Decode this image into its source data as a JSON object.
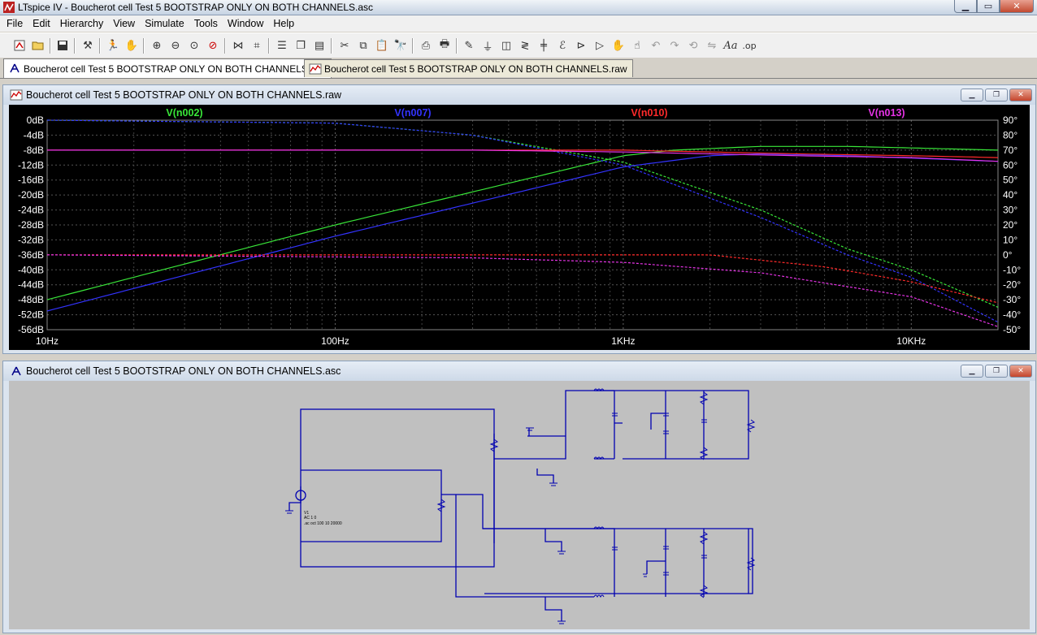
{
  "window": {
    "title": "LTspice IV - Boucherot cell Test 5 BOOTSTRAP ONLY ON BOTH CHANNELS.asc",
    "buttons": [
      "minimize-icon",
      "maximize-icon",
      "close-icon"
    ]
  },
  "menu": [
    "File",
    "Edit",
    "Hierarchy",
    "View",
    "Simulate",
    "Tools",
    "Window",
    "Help"
  ],
  "toolbar": {
    "icons": [
      "new-schematic-icon",
      "open-icon",
      "save-icon",
      "control-panel-icon",
      "run-icon",
      "halt-icon",
      "zoom-in-icon",
      "zoom-out-icon",
      "zoom-fit-icon",
      "cancel-zoom-icon",
      "autorange-icon",
      "cursor-icon",
      "tile-vertical-icon",
      "cascade-icon",
      "tile-horizontal-icon",
      "cut-icon",
      "copy-icon",
      "paste-icon",
      "find-icon",
      "print-setup-icon",
      "print-icon",
      "wire-icon",
      "ground-icon",
      "label-icon",
      "resistor-icon",
      "capacitor-icon",
      "inductor-icon",
      "diode-icon",
      "component-icon",
      "move-icon",
      "drag-icon",
      "undo-icon",
      "redo-icon",
      "rotate-icon",
      "mirror-icon",
      "text-icon",
      "spice-directive-icon"
    ],
    "text_label": "Aa",
    "op_label": ".op"
  },
  "tabs": [
    {
      "label": "Boucherot cell Test 5 BOOTSTRAP ONLY ON BOTH CHANNELS.asc",
      "icon": "schematic-icon",
      "active": true
    },
    {
      "label": "Boucherot cell Test 5 BOOTSTRAP ONLY ON BOTH CHANNELS.raw",
      "icon": "waveform-icon",
      "active": false
    }
  ],
  "plot_window": {
    "title": "Boucherot cell Test 5 BOOTSTRAP ONLY ON BOTH CHANNELS.raw"
  },
  "schematic_window": {
    "title": "Boucherot cell Test 5 BOOTSTRAP ONLY ON BOTH CHANNELS.asc",
    "source_labels": [
      "V1",
      "AC 1 0",
      ".ac oct 100 10 20000"
    ]
  },
  "chart_data": {
    "type": "line",
    "x_scale": "log",
    "xlim": [
      10,
      20000
    ],
    "x_ticks": [
      {
        "value": 10,
        "label": "10Hz"
      },
      {
        "value": 100,
        "label": "100Hz"
      },
      {
        "value": 1000,
        "label": "1KHz"
      },
      {
        "value": 10000,
        "label": "10KHz"
      }
    ],
    "ylim": [
      -56,
      0
    ],
    "y_ticks": [
      "0dB",
      "-4dB",
      "-8dB",
      "-12dB",
      "-16dB",
      "-20dB",
      "-24dB",
      "-28dB",
      "-32dB",
      "-36dB",
      "-40dB",
      "-44dB",
      "-48dB",
      "-52dB",
      "-56dB"
    ],
    "y_tick_values": [
      0,
      -4,
      -8,
      -12,
      -16,
      -20,
      -24,
      -28,
      -32,
      -36,
      -40,
      -44,
      -48,
      -52,
      -56
    ],
    "y2lim": [
      -50,
      90
    ],
    "y2_ticks": [
      "90°",
      "80°",
      "70°",
      "60°",
      "50°",
      "40°",
      "30°",
      "20°",
      "10°",
      "0°",
      "-10°",
      "-20°",
      "-30°",
      "-40°",
      "-50°"
    ],
    "y2_tick_values": [
      90,
      80,
      70,
      60,
      50,
      40,
      30,
      20,
      10,
      0,
      -10,
      -20,
      -30,
      -40,
      -50
    ],
    "grid": true,
    "background": "#000000",
    "series": [
      {
        "name": "V(n002)",
        "color": "#39e639",
        "magnitude_db": {
          "x": [
            10,
            100,
            1000,
            1500,
            3000,
            6000,
            20000
          ],
          "y": [
            -48,
            -28,
            -9.5,
            -8,
            -7,
            -7,
            -8
          ]
        },
        "phase_deg": {
          "x": [
            10,
            100,
            300,
            1000,
            3000,
            6000,
            10000,
            20000
          ],
          "y": [
            90,
            88,
            80,
            62,
            30,
            4,
            -10,
            -35
          ]
        }
      },
      {
        "name": "V(n007)",
        "color": "#3333ff",
        "magnitude_db": {
          "x": [
            10,
            100,
            1000,
            2000,
            3000,
            6000,
            20000
          ],
          "y": [
            -51,
            -31,
            -12.5,
            -9.5,
            -9,
            -9.5,
            -11
          ]
        },
        "phase_deg": {
          "x": [
            10,
            100,
            300,
            1000,
            3000,
            6000,
            10000,
            20000
          ],
          "y": [
            90,
            88,
            80,
            60,
            25,
            0,
            -15,
            -45
          ]
        }
      },
      {
        "name": "V(n010)",
        "color": "#ff2a2a",
        "magnitude_db": {
          "x": [
            10,
            300,
            1000,
            2000,
            4000,
            10000,
            20000
          ],
          "y": [
            -8,
            -8,
            -8,
            -8.5,
            -9,
            -9.5,
            -10
          ]
        },
        "phase_deg": {
          "x": [
            10,
            300,
            1000,
            2000,
            5000,
            10000,
            20000
          ],
          "y": [
            0,
            0,
            0,
            0,
            -8,
            -18,
            -32
          ]
        }
      },
      {
        "name": "V(n013)",
        "color": "#e633e6",
        "magnitude_db": {
          "x": [
            10,
            300,
            1000,
            2000,
            4000,
            10000,
            20000
          ],
          "y": [
            -8,
            -8,
            -8.5,
            -9,
            -9.5,
            -10,
            -11
          ]
        },
        "phase_deg": {
          "x": [
            10,
            300,
            1000,
            3000,
            10000,
            20000
          ],
          "y": [
            0,
            -2,
            -5,
            -12,
            -28,
            -48
          ]
        }
      }
    ]
  }
}
